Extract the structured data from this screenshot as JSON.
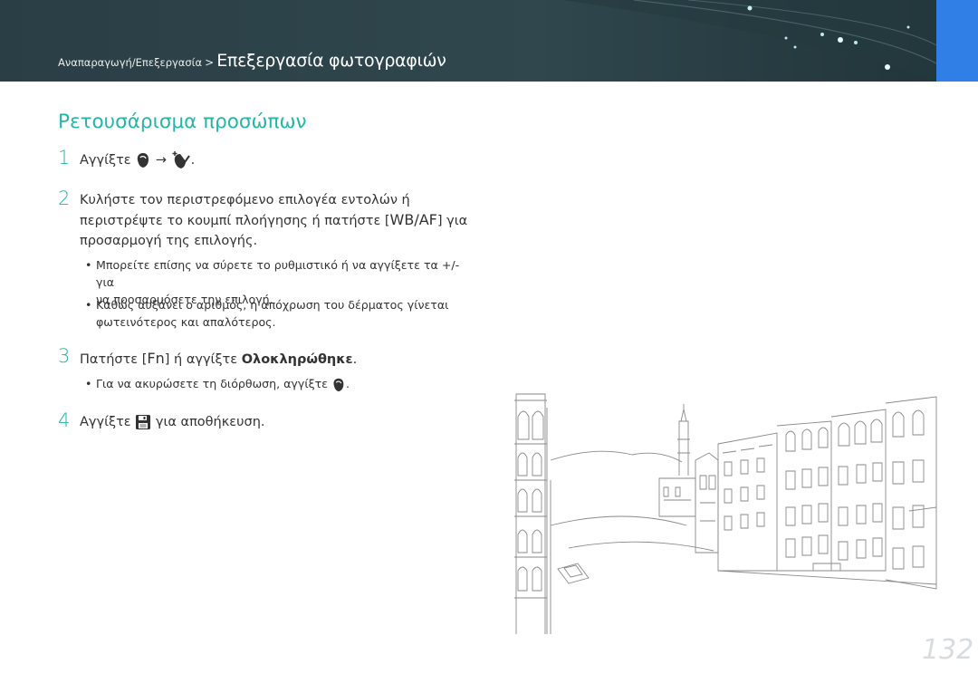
{
  "header": {
    "breadcrumb_small": "Αναπαραγωγή/Επεξεργασία",
    "breadcrumb_separator": ">",
    "breadcrumb_big": "Επεξεργασία φωτογραφιών",
    "accent_color": "#2f7fe6",
    "background_color": "#2a3f45"
  },
  "section_title": "Ρετουσάρισμα προσώπων",
  "steps": [
    {
      "number": "1",
      "text_before": "Αγγίξτε",
      "arrow": "→",
      "text_after": "."
    },
    {
      "number": "2",
      "line1": "Κυλήστε τον περιστρεφόμενο επιλογέα εντολών ή",
      "line2_before": "περιστρέψτε το κουμπί πλοήγησης ή πατήστε [",
      "key": "WB/AF",
      "line2_after": "] για",
      "line3": "προσαρμογή της επιλογής."
    },
    {
      "number": "3",
      "text_before": "Πατήστε [",
      "key": "Fn",
      "text_middle": "] ή αγγίξτε ",
      "bold": "Ολοκληρώθηκε",
      "text_after": "."
    },
    {
      "number": "4",
      "text_before": "Αγγίξτε",
      "text_after": "για αποθήκευση."
    }
  ],
  "bullets_step2": [
    {
      "line1": "Μπορείτε επίσης να σύρετε το ρυθμιστικό ή να αγγίξετε τα +/- για",
      "line2": "να προσαρμόσετε την επιλογή."
    },
    {
      "line1": "Καθώς αυξάνει ο αριθμός, η απόχρωση του δέρματος γίνεται",
      "line2": "φωτεινότερος και απαλότερος."
    }
  ],
  "bullets_step3": [
    {
      "text_before": "Για να ακυρώσετε τη διόρθωση, αγγίξτε",
      "text_after": "."
    }
  ],
  "bullet_char": "•",
  "icons": [
    "retouch-icon",
    "face-retouch-icon",
    "save-icon"
  ],
  "page_number": "132"
}
